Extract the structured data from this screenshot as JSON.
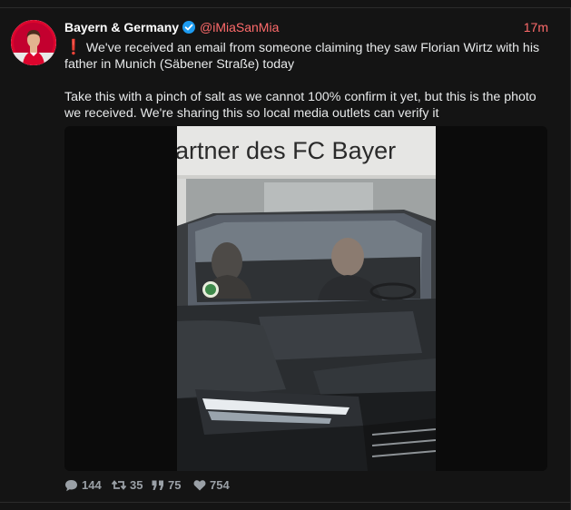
{
  "post": {
    "display_name": "Bayern & Germany",
    "handle": "@iMiaSanMia",
    "time": "17m",
    "exclamation": "❗",
    "paragraph1": "We've received an email from someone claiming they saw Florian Wirtz with his father in Munich (Säbener Straße) today",
    "paragraph2": "Take this with a pinch of salt as we cannot 100% confirm it yet, but this is the photo we received. We're sharing this so local media outlets can verify it"
  },
  "media": {
    "sign_text": "artner des FC Bayer"
  },
  "actions": {
    "replies": "144",
    "retweets": "35",
    "quotes": "75",
    "likes": "754"
  },
  "colors": {
    "background": "#141414",
    "handle": "#ff6b6b",
    "verified": "#1d9bf0",
    "action_gray": "#9aa0a6"
  },
  "icons": [
    "avatar-image",
    "verified-icon",
    "reply-icon",
    "retweet-icon",
    "quote-icon",
    "heart-icon"
  ]
}
